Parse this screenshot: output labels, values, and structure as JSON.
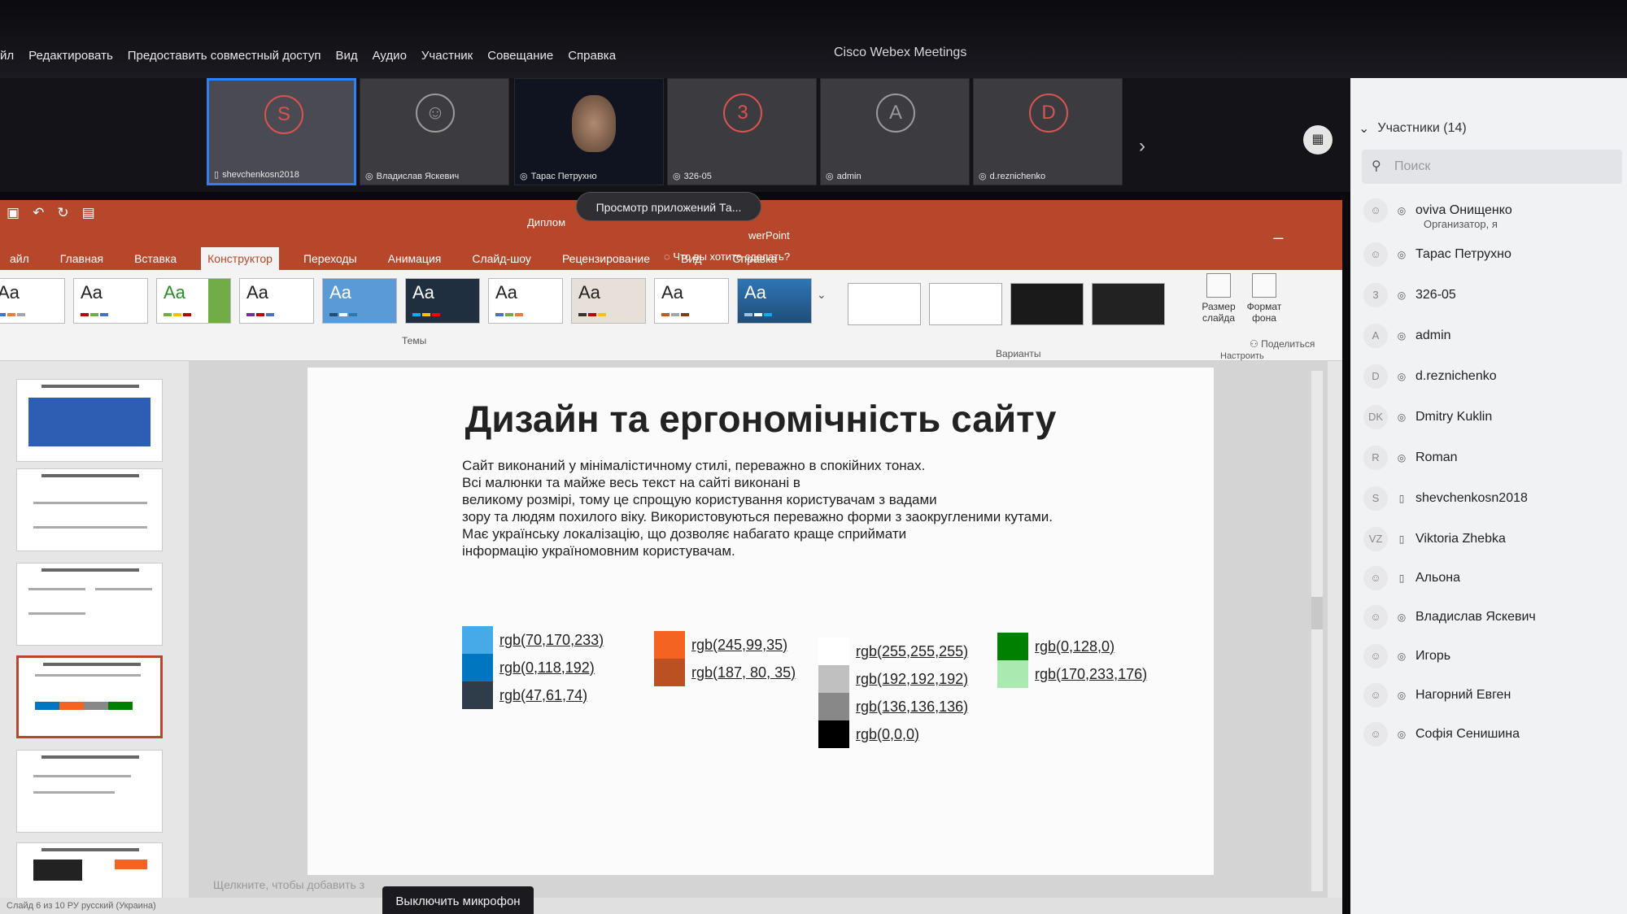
{
  "webex": {
    "title": "Cisco Webex Meetings",
    "menu": [
      "йл",
      "Редактировать",
      "Предоставить совместный доступ",
      "Вид",
      "Аудио",
      "Участник",
      "Совещание",
      "Справка"
    ],
    "tooltip": "Просмотр приложений Та...",
    "tiles": [
      {
        "initial": "S",
        "name": "shevchenkosn2018"
      },
      {
        "initial": "",
        "name": "Владислав Яскевич"
      },
      {
        "initial": "",
        "name": "Тарас Петрухно"
      },
      {
        "initial": "3",
        "name": "326-05"
      },
      {
        "initial": "A",
        "name": "admin"
      },
      {
        "initial": "D",
        "name": "d.reznichenko"
      }
    ],
    "mute_button": "Выключить микрофон"
  },
  "ppt": {
    "doc_title": "Диплом",
    "doc_app": "werPoint",
    "tabs": [
      "айл",
      "Главная",
      "Вставка",
      "Конструктор",
      "Переходы",
      "Анимация",
      "Слайд-шоу",
      "Рецензирование",
      "Вид",
      "Справка"
    ],
    "tell_me": "Что вы хотите сделать?",
    "share": "Поделиться",
    "theme_sample": "Aa",
    "themes_label": "Темы",
    "variants_label": "Варианты",
    "slide_size": "Размер слайда",
    "format_bg": "Формат фона",
    "customize_label": "Настроить",
    "notes_placeholder": "Щелкните, чтобы добавить з",
    "status": "Слайд 6 из 10   РУ   русский (Украина)"
  },
  "slide": {
    "title": "Дизайн та ергономічність сайту",
    "body": [
      "Сайт  виконаний у мінімалістичному стилі, переважно в спокійних тонах.",
      "Всі малюнки та майже весь текст на сайті виконані в",
      "великому розмірі, тому це спрощую користування користувачам з вадами",
      "зору та людям похилого віку.  Використовуються переважно форми з заокругленими кутами.",
      "Має українську локалізацію, що дозволяє набагато краще сприймати",
      "інформацію україномовним користувачам."
    ],
    "colors": {
      "blue": [
        {
          "label": "rgb(70,170,233)",
          "hex": "#46aae9"
        },
        {
          "label": "rgb(0,118,192)",
          "hex": "#0076c0"
        },
        {
          "label": "rgb(47,61,74)",
          "hex": "#2f3d4a"
        }
      ],
      "orange": [
        {
          "label": "rgb(245,99,35)",
          "hex": "#f56323"
        },
        {
          "label": "rgb(187, 80, 35)",
          "hex": "#bb5023"
        }
      ],
      "gray": [
        {
          "label": "rgb(255,255,255)",
          "hex": "#ffffff"
        },
        {
          "label": "rgb(192,192,192)",
          "hex": "#c0c0c0"
        },
        {
          "label": "rgb(136,136,136)",
          "hex": "#888888"
        },
        {
          "label": "rgb(0,0,0)",
          "hex": "#000000"
        }
      ],
      "green": [
        {
          "label": "rgb(0,128,0)",
          "hex": "#008000"
        },
        {
          "label": "rgb(170,233,176)",
          "hex": "#aae9b0"
        }
      ]
    }
  },
  "participants": {
    "header": "Участники (14)",
    "search_placeholder": "Поиск",
    "list": [
      {
        "initial": "",
        "name": "oviva Онищенко",
        "role": "Организатор, я"
      },
      {
        "initial": "",
        "name": "Тарас Петрухно"
      },
      {
        "initial": "3",
        "name": "326-05"
      },
      {
        "initial": "A",
        "name": "admin"
      },
      {
        "initial": "D",
        "name": "d.reznichenko"
      },
      {
        "initial": "DK",
        "name": "Dmitry Kuklin"
      },
      {
        "initial": "R",
        "name": "Roman"
      },
      {
        "initial": "S",
        "name": "shevchenkosn2018"
      },
      {
        "initial": "VZ",
        "name": "Viktoria Zhebka"
      },
      {
        "initial": "",
        "name": "Альона"
      },
      {
        "initial": "",
        "name": "Владислав Яскевич"
      },
      {
        "initial": "",
        "name": "Игорь"
      },
      {
        "initial": "",
        "name": "Нагорний Евген"
      },
      {
        "initial": "",
        "name": "Софія Сенишина"
      }
    ]
  }
}
